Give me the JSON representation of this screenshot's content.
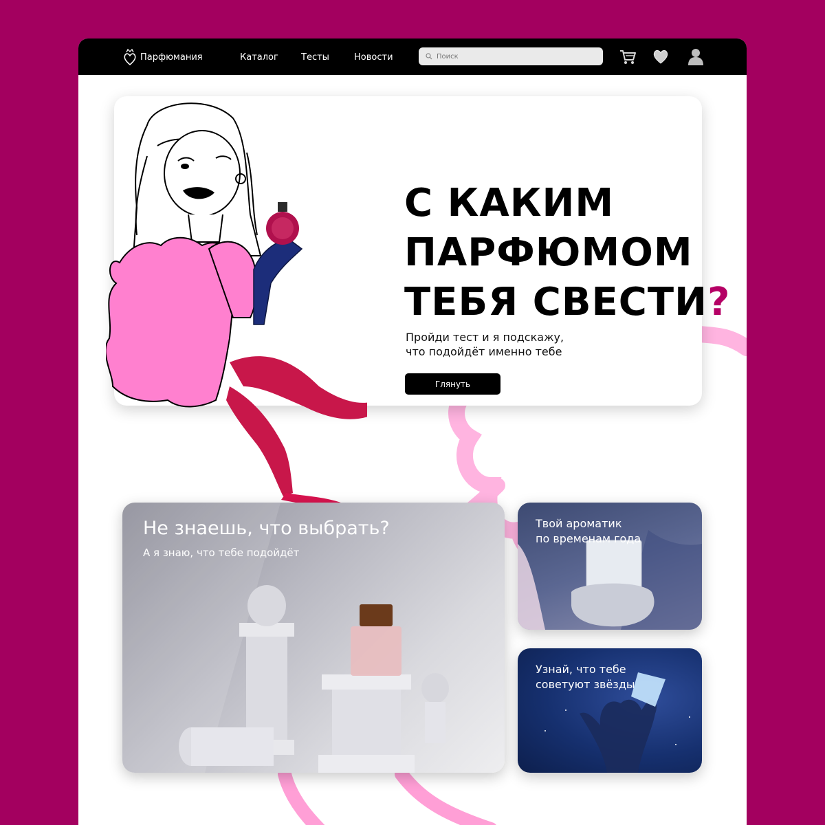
{
  "nav": {
    "logo_text": "Парфюмания",
    "links": [
      "Каталог",
      "Тесты",
      "Новости"
    ],
    "search_placeholder": "Поиск"
  },
  "hero": {
    "title_lines": [
      "С каким",
      "парфюмом",
      "тебя свести"
    ],
    "title_mark": "?",
    "subtitle_lines": [
      "Пройди тест и я подскажу,",
      "что подойдёт именно тебе"
    ],
    "button_label": "Глянуть"
  },
  "cards": {
    "choose": {
      "title": "Не знаешь, что выбрать?",
      "subtitle": "А я знаю, что тебе подойдёт"
    },
    "seasons": {
      "title_lines": [
        "Твой ароматик",
        "по временам года"
      ]
    },
    "stars": {
      "title_lines": [
        "Узнай, что тебе",
        "советуют звёзды"
      ]
    }
  },
  "theme": {
    "background": "#a3005f",
    "accent_pink": "#ff8ad0",
    "navbar": "#000000"
  }
}
